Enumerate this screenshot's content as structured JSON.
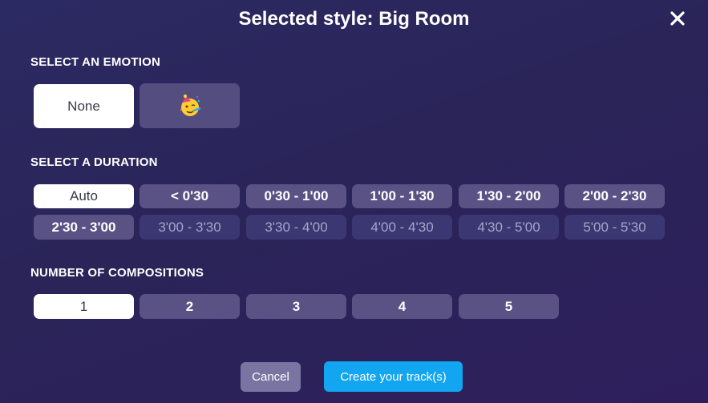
{
  "modal": {
    "title": "Selected style: Big Room"
  },
  "emotion": {
    "label": "SELECT AN EMOTION",
    "options": [
      "None",
      "party-face-emoji"
    ],
    "selected": "None"
  },
  "duration": {
    "label": "SELECT A DURATION",
    "options": [
      "Auto",
      "< 0'30",
      "0'30 - 1'00",
      "1'00 - 1'30",
      "1'30 - 2'00",
      "2'00 - 2'30",
      "2'30 - 3'00",
      "3'00 - 3'30",
      "3'30 - 4'00",
      "4'00 - 4'30",
      "4'30 - 5'00",
      "5'00 - 5'30"
    ],
    "selected": "Auto"
  },
  "compositions": {
    "label": "NUMBER OF COMPOSITIONS",
    "options": [
      "1",
      "2",
      "3",
      "4",
      "5"
    ],
    "selected": "1"
  },
  "actions": {
    "cancel_label": "Cancel",
    "create_label": "Create your track(s)"
  },
  "colors": {
    "background": "#2a2458",
    "accent": "#12a5f0",
    "selected_option": "#ffffff",
    "option": "#5a5285",
    "disabled_option": "#3b3772"
  }
}
